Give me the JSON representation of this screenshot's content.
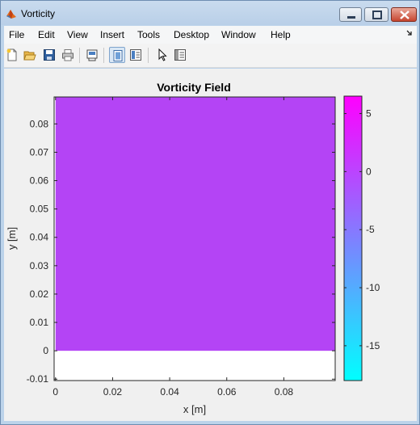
{
  "window": {
    "title": "Vorticity"
  },
  "menu": {
    "items": [
      {
        "label": "File"
      },
      {
        "label": "Edit"
      },
      {
        "label": "View"
      },
      {
        "label": "Insert"
      },
      {
        "label": "Tools"
      },
      {
        "label": "Desktop"
      },
      {
        "label": "Window"
      },
      {
        "label": "Help"
      }
    ]
  },
  "toolbar": {
    "buttons": [
      {
        "icon": "new-figure-icon"
      },
      {
        "icon": "open-file-icon"
      },
      {
        "icon": "save-figure-icon"
      },
      {
        "icon": "print-figure-icon"
      },
      {
        "icon": "link-plot-icon"
      },
      {
        "icon": "hide-plot-tools-icon"
      },
      {
        "icon": "show-plot-tools-icon"
      },
      {
        "icon": "edit-plot-icon"
      },
      {
        "icon": "open-property-inspector-icon"
      }
    ]
  },
  "chart_data": {
    "type": "heatmap",
    "title": "Vorticity Field",
    "xlabel": "x [m]",
    "ylabel": "y [m]",
    "xlim": [
      -0.0005,
      0.098
    ],
    "ylim": [
      -0.0105,
      0.0895
    ],
    "xticks": [
      0,
      0.02,
      0.04,
      0.06,
      0.08
    ],
    "xtick_labels": [
      "0",
      "0.02",
      "0.04",
      "0.06",
      "0.08"
    ],
    "yticks": [
      -0.01,
      0,
      0.01,
      0.02,
      0.03,
      0.04,
      0.05,
      0.06,
      0.07,
      0.08
    ],
    "ytick_labels": [
      "-0.01",
      "0",
      "0.01",
      "0.02",
      "0.03",
      "0.04",
      "0.05",
      "0.06",
      "0.07",
      "0.08"
    ],
    "field_extent": {
      "x": [
        0,
        0.098
      ],
      "y": [
        0,
        0.0895
      ]
    },
    "field_value": 0,
    "field_color": "#b444f5",
    "colorbar": {
      "range": [
        -18,
        6.5
      ],
      "ticks": [
        5,
        0,
        -5,
        -10,
        -15
      ],
      "tick_labels": [
        "5",
        "0",
        "-5",
        "-10",
        "-15"
      ],
      "colormap": [
        "#00ffff",
        "#ff00ff"
      ]
    },
    "grid": false
  },
  "colors": {
    "titlebar": "#bcd3ea",
    "figure_bg": "#f0f0f0",
    "axes_bg": "#ffffff"
  }
}
